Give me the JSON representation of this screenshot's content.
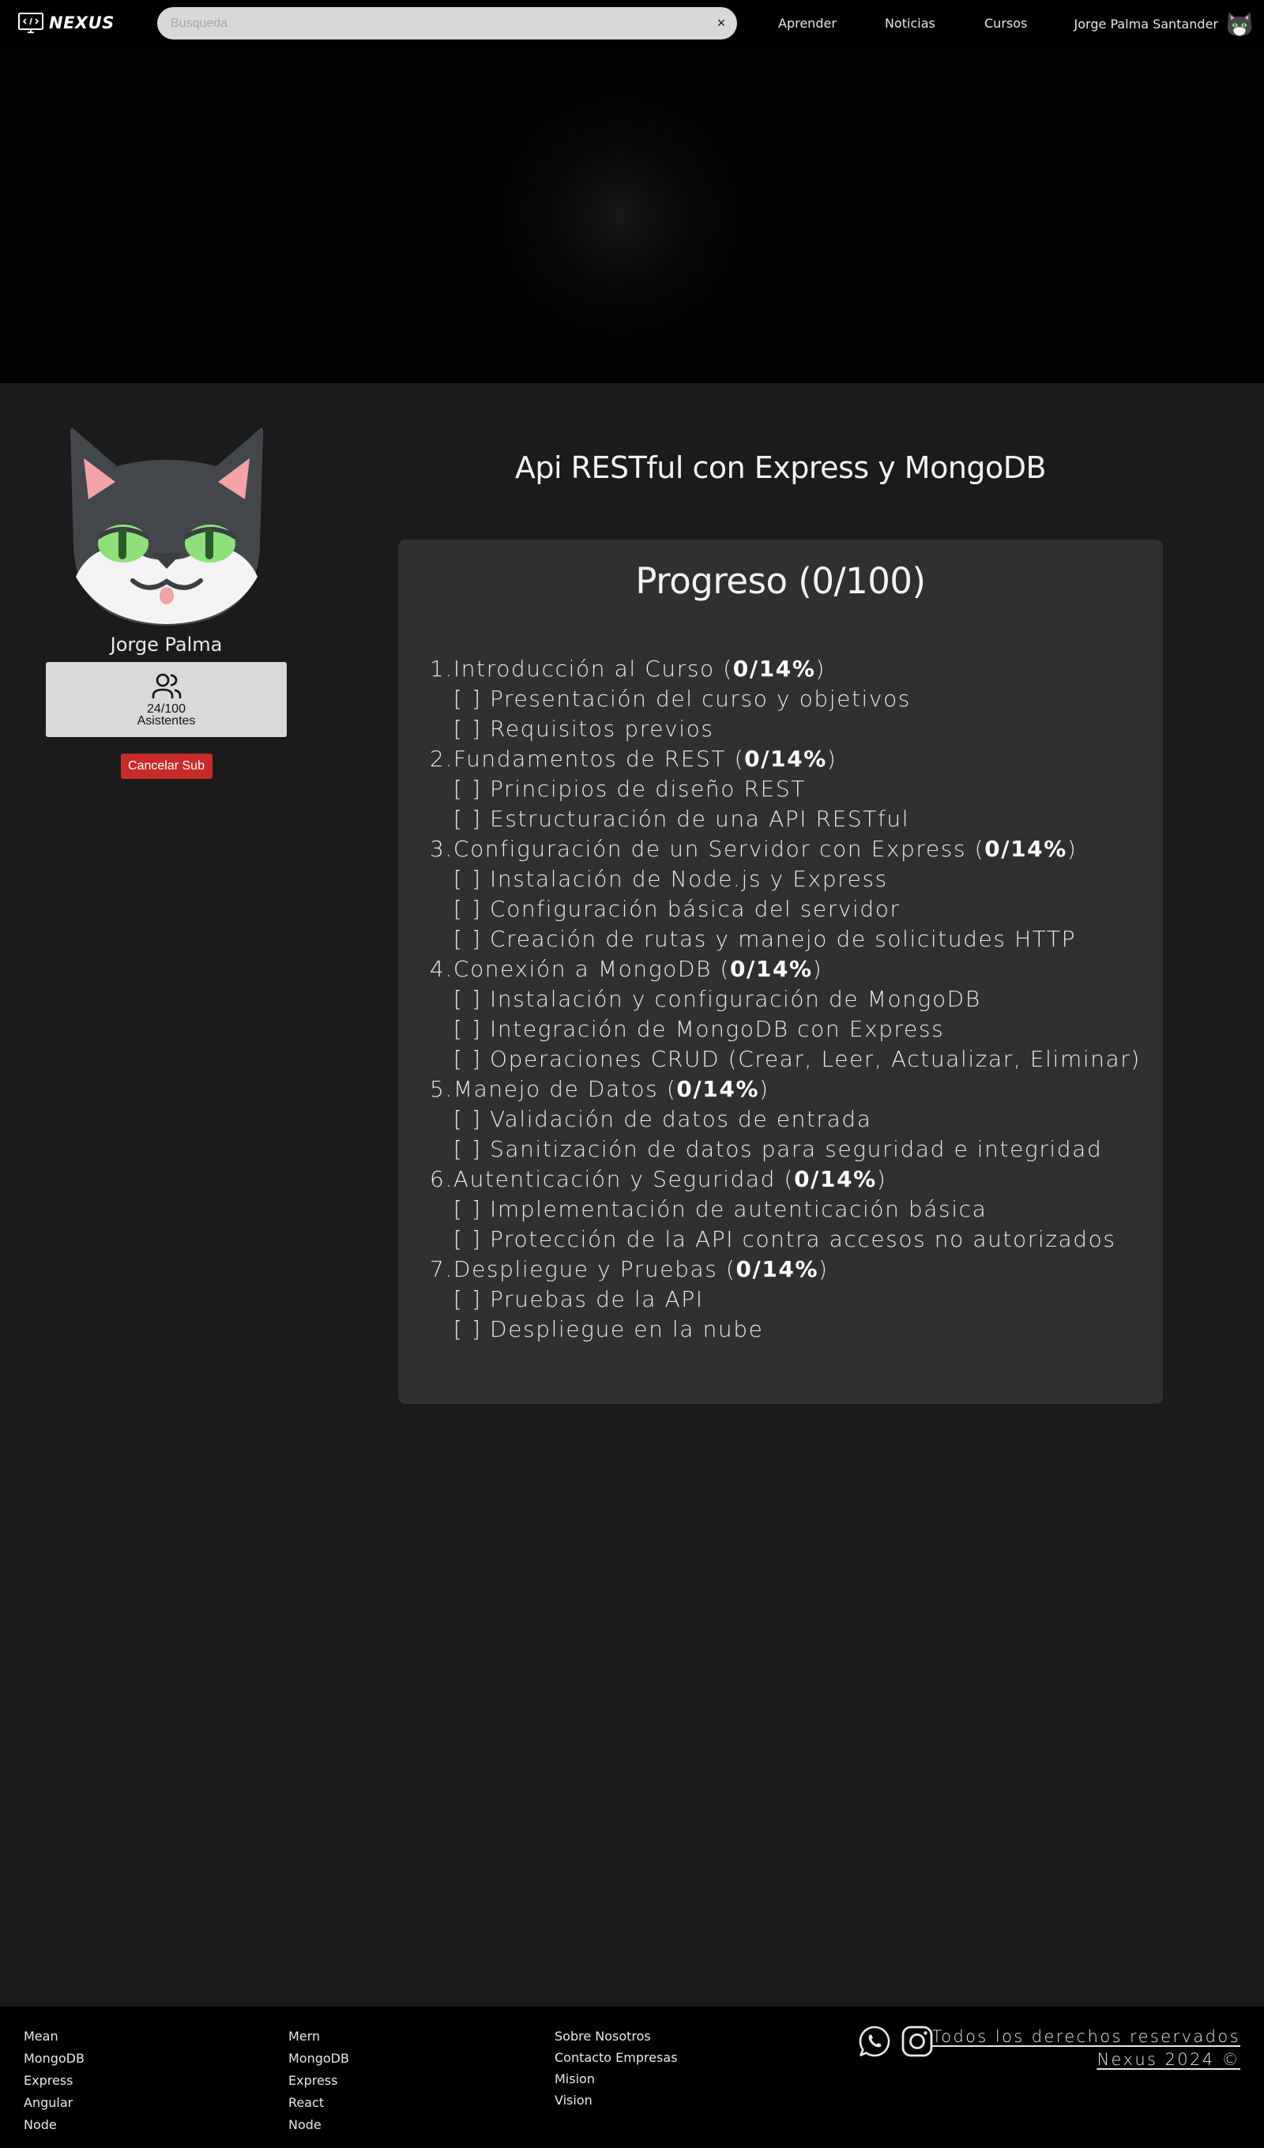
{
  "navbar": {
    "brand": "NEXUS",
    "search_placeholder": "Busqueda",
    "clear_icon": "×",
    "links": [
      "Aprender",
      "Noticias",
      "Cursos"
    ],
    "user_name": "Jorge Palma Santander"
  },
  "profile": {
    "name": "Jorge Palma",
    "attendees_count": "24/100",
    "attendees_label": "Asistentes",
    "cancel_label": "Cancelar Sub"
  },
  "course": {
    "title": "Api RESTful con Express y MongoDB",
    "progress_title": "Progreso (0/100)",
    "modules": [
      {
        "label": "1.Introducción al Curso",
        "percent": "0/14%",
        "topics": [
          "[ ] Presentación del curso y objetivos",
          "[ ] Requisitos previos"
        ]
      },
      {
        "label": "2.Fundamentos de REST",
        "percent": "0/14%",
        "topics": [
          "[ ] Principios de diseño REST",
          "[ ] Estructuración de una API RESTful"
        ]
      },
      {
        "label": "3.Configuración de un Servidor con Express",
        "percent": "0/14%",
        "topics": [
          "[ ] Instalación de Node.js y Express",
          "[ ] Configuración básica del servidor",
          "[ ] Creación de rutas y manejo de solicitudes HTTP"
        ]
      },
      {
        "label": "4.Conexión a MongoDB",
        "percent": "0/14%",
        "topics": [
          "[ ] Instalación y configuración de MongoDB",
          "[ ] Integración de MongoDB con Express",
          "[ ] Operaciones CRUD (Crear, Leer, Actualizar, Eliminar)"
        ]
      },
      {
        "label": "5.Manejo de Datos",
        "percent": "0/14%",
        "topics": [
          "[ ] Validación de datos de entrada",
          "[ ] Sanitización de datos para seguridad e integridad"
        ]
      },
      {
        "label": "6.Autenticación y Seguridad",
        "percent": "0/14%",
        "topics": [
          "[ ] Implementación de autenticación básica",
          "[ ] Protección de la API contra accesos no autorizados"
        ]
      },
      {
        "label": "7.Despliegue y Pruebas",
        "percent": "0/14%",
        "topics": [
          "[ ] Pruebas de la API",
          "[ ] Despliegue en la nube"
        ]
      }
    ]
  },
  "footer": {
    "col1": [
      "Mean",
      "MongoDB",
      "Express",
      "Angular",
      "Node"
    ],
    "col2": [
      "Mern",
      "MongoDB",
      "Express",
      "React",
      "Node"
    ],
    "col3": [
      "Sobre Nosotros",
      "Contacto Empresas",
      "Mision",
      "Vision"
    ],
    "copyright_line1": "Todos los derechos reservados",
    "copyright_line2": "Nexus 2024 ©"
  },
  "icons": {
    "brand": "monitor-code-icon",
    "clear": "close-icon",
    "avatar": "cat-avatar-icon",
    "attendees": "users-icon",
    "whatsapp": "whatsapp-icon",
    "instagram": "instagram-icon"
  },
  "colors": {
    "page_bg": "#1b1b1b",
    "navbar_bg": "#000000",
    "card_bg": "#303030",
    "cancel_button": "#c92a2a",
    "attendees_bg": "#d9d9d9"
  }
}
